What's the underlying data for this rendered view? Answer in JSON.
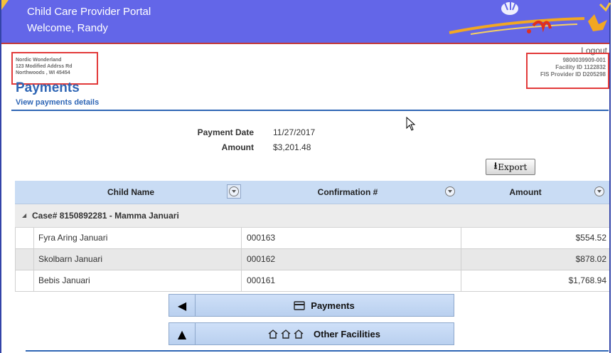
{
  "header": {
    "title": "Child Care Provider Portal",
    "welcome": "Welcome, Randy"
  },
  "provider": {
    "name": "Nordic Wonderland",
    "address1": "123 Modified Addrss Rd",
    "address2": "Northwoods , WI 45454"
  },
  "ids": {
    "logout": "Logout",
    "provider_number": "9800039909-001",
    "facility": "Facility ID 1122832",
    "fis": "FIS Provider ID D205298"
  },
  "page": {
    "title": "Payments",
    "subtitle": "View payments details"
  },
  "summary": {
    "date_label": "Payment Date",
    "date_value": "11/27/2017",
    "amount_label": "Amount",
    "amount_value": "$3,201.48"
  },
  "export_label": "Export",
  "grid": {
    "columns": [
      "Child Name",
      "Confirmation #",
      "Amount"
    ],
    "group": "Case# 8150892281 - Mamma Januari",
    "rows": [
      {
        "child": "Fyra Aring Januari",
        "confirmation": "000163",
        "amount": "$554.52"
      },
      {
        "child": "Skolbarn Januari",
        "confirmation": "000162",
        "amount": "$878.02"
      },
      {
        "child": "Bebis Januari",
        "confirmation": "000161",
        "amount": "$1,768.94"
      }
    ]
  },
  "nav": {
    "payments": "Payments",
    "other_facilities": "Other Facilities"
  },
  "colors": {
    "header_bg": "#6366e8",
    "accent_blue": "#2f66b5",
    "highlight_red": "#e23a3a",
    "grid_header": "#c9dcf4"
  }
}
